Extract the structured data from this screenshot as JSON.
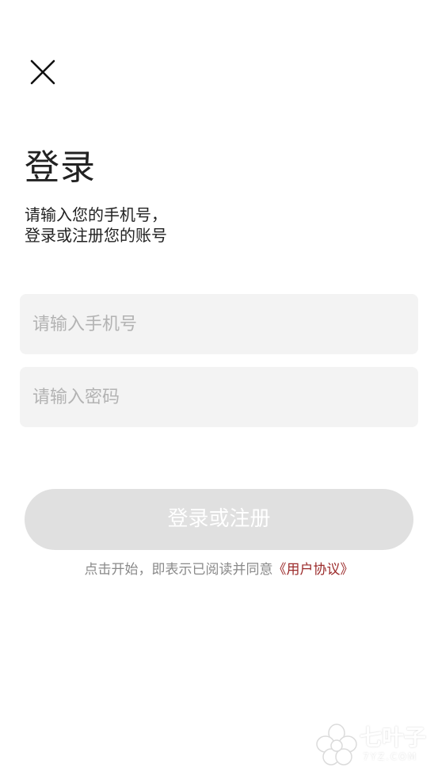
{
  "header": {
    "close_icon": "close-icon"
  },
  "login": {
    "title": "登录",
    "subtitle_line1": "请输入您的手机号，",
    "subtitle_line2": "登录或注册您的账号"
  },
  "form": {
    "phone_placeholder": "请输入手机号",
    "phone_value": "",
    "password_placeholder": "请输入密码",
    "password_value": ""
  },
  "submit": {
    "label": "登录或注册",
    "enabled": false,
    "color": "#e0e0e0"
  },
  "agreement": {
    "prefix": "点击开始，即表示已阅读并同意",
    "link_text": "《用户协议》",
    "link_color": "#9b2a2a"
  },
  "watermark": {
    "text": "七叶子",
    "subtext": "7YZ.COM"
  }
}
